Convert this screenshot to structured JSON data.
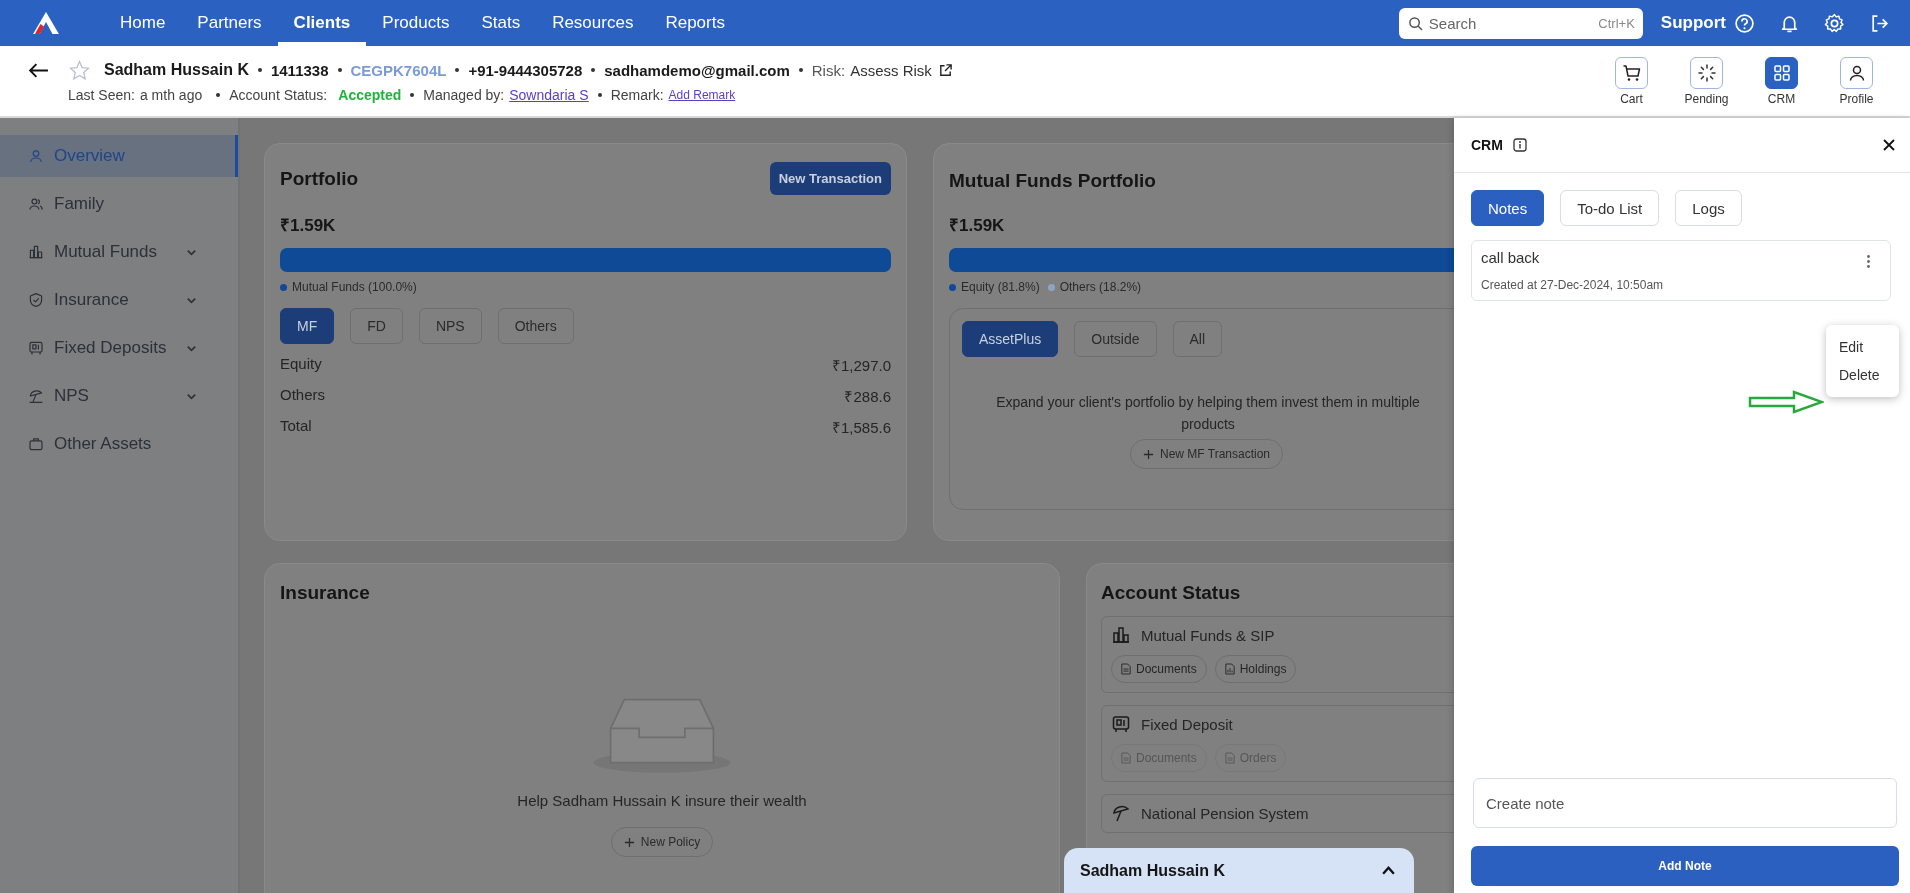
{
  "nav": {
    "items": [
      {
        "label": "Home",
        "selected": false
      },
      {
        "label": "Partners",
        "selected": false
      },
      {
        "label": "Clients",
        "selected": true
      },
      {
        "label": "Products",
        "selected": false
      },
      {
        "label": "Stats",
        "selected": false
      },
      {
        "label": "Resources",
        "selected": false
      },
      {
        "label": "Reports",
        "selected": false
      }
    ],
    "search": {
      "placeholder": "Search",
      "shortcut": "Ctrl+K"
    },
    "support": "Support"
  },
  "client": {
    "name": "Sadham Hussain K",
    "id": "1411338",
    "pan": "CEGPK7604L",
    "phone": "+91-9444305728",
    "email": "sadhamdemo@gmail.com",
    "risk_label": "Risk:",
    "risk_value": "Assess Risk",
    "last_seen_label": "Last Seen:",
    "last_seen": "a mth ago",
    "status_label": "Account Status:",
    "status": "Accepted",
    "managed_label": "Managed by:",
    "manager": "Sowndaria S",
    "remark_label": "Remark:",
    "remark_action": "Add Remark"
  },
  "actions": [
    {
      "label": "Cart",
      "kind": "cart",
      "selected": false
    },
    {
      "label": "Pending",
      "kind": "pending",
      "selected": false
    },
    {
      "label": "CRM",
      "kind": "crm",
      "selected": true
    },
    {
      "label": "Profile",
      "kind": "profile",
      "selected": false
    }
  ],
  "sidebar": {
    "items": [
      {
        "label": "Overview",
        "kind": "person",
        "expandable": false,
        "selected": true
      },
      {
        "label": "Family",
        "kind": "people",
        "expandable": false,
        "selected": false
      },
      {
        "label": "Mutual Funds",
        "kind": "chart",
        "expandable": true,
        "selected": false
      },
      {
        "label": "Insurance",
        "kind": "shield",
        "expandable": true,
        "selected": false
      },
      {
        "label": "Fixed Deposits",
        "kind": "safe",
        "expandable": true,
        "selected": false
      },
      {
        "label": "NPS",
        "kind": "umbrella",
        "expandable": true,
        "selected": false
      },
      {
        "label": "Other Assets",
        "kind": "briefcase",
        "expandable": false,
        "selected": false
      }
    ]
  },
  "portfolio": {
    "title": "Portfolio",
    "action": "New Transaction",
    "total": "₹1.59K",
    "bar": [
      {
        "label": "Mutual Funds (100.0%)",
        "color": "#0e4a96"
      }
    ],
    "tabs": [
      {
        "label": "MF",
        "selected": true
      },
      {
        "label": "FD",
        "selected": false
      },
      {
        "label": "NPS",
        "selected": false
      },
      {
        "label": "Others",
        "selected": false
      }
    ],
    "rows": [
      {
        "label": "Equity",
        "value": "₹1,297.0"
      },
      {
        "label": "Others",
        "value": "₹288.6"
      },
      {
        "label": "Total",
        "value": "₹1,585.6"
      }
    ]
  },
  "mf_portfolio": {
    "title": "Mutual Funds Portfolio",
    "total": "₹1.59K",
    "bar": [
      {
        "label": "Equity (81.8%)",
        "color": "#0e4a96"
      },
      {
        "label": "Others (18.2%)",
        "color": "#8fa4c4"
      }
    ],
    "tabs": [
      {
        "label": "AssetPlus",
        "selected": true
      },
      {
        "label": "Outside",
        "selected": false
      },
      {
        "label": "All",
        "selected": false
      }
    ],
    "message_lines": [
      "Expand your client's portfolio by helping them invest them in multiple",
      "products"
    ],
    "action": "New MF Transaction"
  },
  "insurance": {
    "title": "Insurance",
    "message": "Help Sadham Hussain K insure their wealth",
    "action": "New Policy"
  },
  "account_status": {
    "title": "Account Status",
    "sections": [
      {
        "kind": "mf",
        "label": "Mutual Funds & SIP",
        "links": [
          {
            "kind": "documents",
            "label": "Documents",
            "disabled": false
          },
          {
            "kind": "holdings",
            "label": "Holdings",
            "disabled": false
          }
        ]
      },
      {
        "kind": "fd",
        "label": "Fixed Deposit",
        "links": [
          {
            "kind": "documents",
            "label": "Documents",
            "disabled": true
          },
          {
            "kind": "orders",
            "label": "Orders",
            "disabled": true
          }
        ]
      },
      {
        "kind": "nps",
        "label": "National Pension System"
      }
    ]
  },
  "floating_bar": {
    "name": "Sadham Hussain K"
  },
  "crm": {
    "title": "CRM",
    "tabs": [
      {
        "label": "Notes",
        "selected": true
      },
      {
        "label": "To-do List",
        "selected": false
      },
      {
        "label": "Logs",
        "selected": false
      }
    ],
    "notes": [
      {
        "text": "call back",
        "created": "Created at 27-Dec-2024, 10:50am"
      }
    ],
    "menu": [
      "Edit",
      "Delete"
    ],
    "input": {
      "placeholder": "Create note"
    },
    "submit": "Add Note"
  }
}
